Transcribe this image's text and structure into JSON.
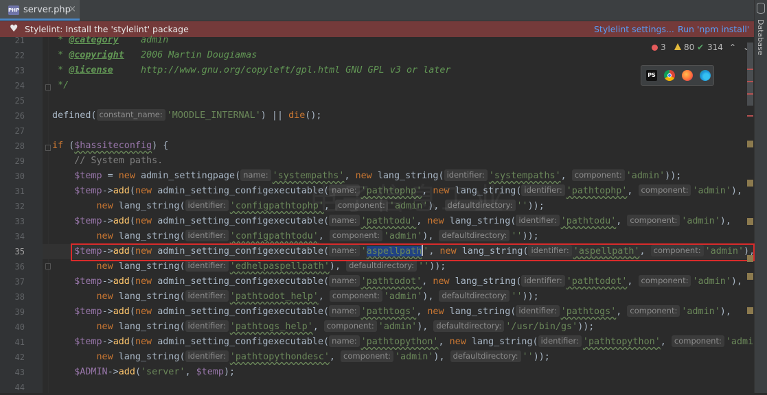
{
  "tab": {
    "label": "server.php",
    "icon": "php-file-icon",
    "badge": "PHP"
  },
  "right_panel": {
    "label": "Database",
    "icon": "database-icon"
  },
  "banner": {
    "icon": "stylelint-icon",
    "message": "Stylelint: Install the 'stylelint' package",
    "link_settings": "Stylelint settings...",
    "link_install": "Run 'npm install'"
  },
  "inspections": {
    "errors": "3",
    "warnings": "80",
    "ok": "314",
    "up": "⌃",
    "down": "⌄"
  },
  "browsers": [
    {
      "name": "phpstorm-icon",
      "label": "PS"
    },
    {
      "name": "chrome-icon"
    },
    {
      "name": "firefox-icon"
    },
    {
      "name": "edge-icon"
    }
  ],
  "line_numbers": [
    "21",
    "22",
    "23",
    "24",
    "25",
    "26",
    "27",
    "28",
    "29",
    "30",
    "31",
    "32",
    "33",
    "34",
    "35",
    "36",
    "37",
    "38",
    "39",
    "40",
    "41",
    "42",
    "43",
    "44"
  ],
  "code": {
    "l21": {
      "star": " * ",
      "tag": "@category",
      "sp": "    ",
      "val": "admin"
    },
    "l22": {
      "star": " * ",
      "tag": "@copyright",
      "sp": "   ",
      "val": "2006 Martin Dougiamas"
    },
    "l23": {
      "star": " * ",
      "tag": "@license",
      "sp": "     ",
      "val": "http://www.gnu.org/copyleft/gpl.html GNU GPL v3 or later"
    },
    "l24": {
      "text": " */"
    },
    "l26": {
      "fn": "defined(",
      "hint": "constant_name:",
      "str": "'MOODLE_INTERNAL'",
      "mid": ") || ",
      "kw": "die",
      "end": "();"
    },
    "l28": {
      "kw": "if",
      "open": " (",
      "var": "$hassiteconfig",
      "close": ") {"
    },
    "l29": {
      "comment": "    // System paths."
    },
    "paths": {
      "var": "$temp",
      "new": "new",
      "arrow": "->",
      "add": "add",
      "cls_page": "admin_settingpage",
      "cls_exec": "admin_setting_configexecutable",
      "cls_str": "lang_string",
      "h_name": "name:",
      "h_identifier": "identifier:",
      "h_component": "component:",
      "h_defaultdir": "defaultdirectory:",
      "s_systempaths": "'systempaths'",
      "s_admin": "'admin'",
      "s_pathtophp": "'pathtophp'",
      "s_configpathtophp": "'configpathtophp'",
      "s_empty": "''",
      "s_pathtodu": "'pathtodu'",
      "s_configpathtodu": "'configpathtodu'",
      "s_aspell_q1": "'",
      "s_aspell_sel": "aspellpath",
      "s_aspell_q2": "'",
      "s_aspellpath": "'aspellpath'",
      "s_edhelp": "'edhelpaspellpath'",
      "s_pathtodot": "'pathtodot'",
      "s_pathtodot_help": "'pathtodot_help'",
      "s_pathtogs": "'pathtogs'",
      "s_pathtogs_help": "'pathtogs_help'",
      "s_usrbings": "'/usr/bin/gs'",
      "s_pathtopython": "'pathtopython'",
      "s_pathtopythondesc": "'pathtopythondesc'",
      "s_admi_cut": "'admi"
    },
    "l43": {
      "var": "$ADMIN",
      "arrow": "->",
      "add": "add",
      "open": "(",
      "str": "'server'",
      "comma": ", ",
      "var2": "$temp",
      "end": ");"
    }
  },
  "watermark": "电子信息工业"
}
